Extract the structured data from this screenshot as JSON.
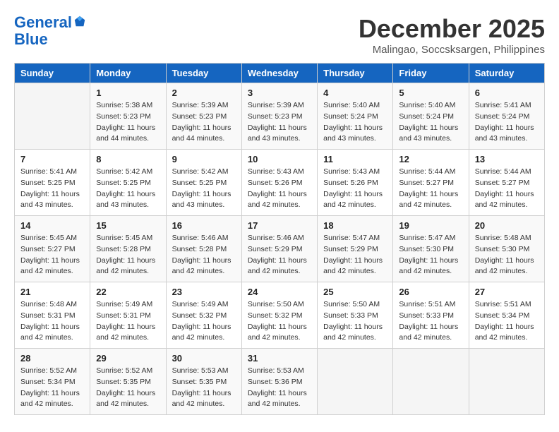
{
  "header": {
    "logo_line1": "General",
    "logo_line2": "Blue",
    "month": "December 2025",
    "location": "Malingao, Soccsksargen, Philippines"
  },
  "weekdays": [
    "Sunday",
    "Monday",
    "Tuesday",
    "Wednesday",
    "Thursday",
    "Friday",
    "Saturday"
  ],
  "weeks": [
    [
      {
        "day": "",
        "info": ""
      },
      {
        "day": "1",
        "info": "Sunrise: 5:38 AM\nSunset: 5:23 PM\nDaylight: 11 hours\nand 44 minutes."
      },
      {
        "day": "2",
        "info": "Sunrise: 5:39 AM\nSunset: 5:23 PM\nDaylight: 11 hours\nand 44 minutes."
      },
      {
        "day": "3",
        "info": "Sunrise: 5:39 AM\nSunset: 5:23 PM\nDaylight: 11 hours\nand 43 minutes."
      },
      {
        "day": "4",
        "info": "Sunrise: 5:40 AM\nSunset: 5:24 PM\nDaylight: 11 hours\nand 43 minutes."
      },
      {
        "day": "5",
        "info": "Sunrise: 5:40 AM\nSunset: 5:24 PM\nDaylight: 11 hours\nand 43 minutes."
      },
      {
        "day": "6",
        "info": "Sunrise: 5:41 AM\nSunset: 5:24 PM\nDaylight: 11 hours\nand 43 minutes."
      }
    ],
    [
      {
        "day": "7",
        "info": "Sunrise: 5:41 AM\nSunset: 5:25 PM\nDaylight: 11 hours\nand 43 minutes."
      },
      {
        "day": "8",
        "info": "Sunrise: 5:42 AM\nSunset: 5:25 PM\nDaylight: 11 hours\nand 43 minutes."
      },
      {
        "day": "9",
        "info": "Sunrise: 5:42 AM\nSunset: 5:25 PM\nDaylight: 11 hours\nand 43 minutes."
      },
      {
        "day": "10",
        "info": "Sunrise: 5:43 AM\nSunset: 5:26 PM\nDaylight: 11 hours\nand 42 minutes."
      },
      {
        "day": "11",
        "info": "Sunrise: 5:43 AM\nSunset: 5:26 PM\nDaylight: 11 hours\nand 42 minutes."
      },
      {
        "day": "12",
        "info": "Sunrise: 5:44 AM\nSunset: 5:27 PM\nDaylight: 11 hours\nand 42 minutes."
      },
      {
        "day": "13",
        "info": "Sunrise: 5:44 AM\nSunset: 5:27 PM\nDaylight: 11 hours\nand 42 minutes."
      }
    ],
    [
      {
        "day": "14",
        "info": "Sunrise: 5:45 AM\nSunset: 5:27 PM\nDaylight: 11 hours\nand 42 minutes."
      },
      {
        "day": "15",
        "info": "Sunrise: 5:45 AM\nSunset: 5:28 PM\nDaylight: 11 hours\nand 42 minutes."
      },
      {
        "day": "16",
        "info": "Sunrise: 5:46 AM\nSunset: 5:28 PM\nDaylight: 11 hours\nand 42 minutes."
      },
      {
        "day": "17",
        "info": "Sunrise: 5:46 AM\nSunset: 5:29 PM\nDaylight: 11 hours\nand 42 minutes."
      },
      {
        "day": "18",
        "info": "Sunrise: 5:47 AM\nSunset: 5:29 PM\nDaylight: 11 hours\nand 42 minutes."
      },
      {
        "day": "19",
        "info": "Sunrise: 5:47 AM\nSunset: 5:30 PM\nDaylight: 11 hours\nand 42 minutes."
      },
      {
        "day": "20",
        "info": "Sunrise: 5:48 AM\nSunset: 5:30 PM\nDaylight: 11 hours\nand 42 minutes."
      }
    ],
    [
      {
        "day": "21",
        "info": "Sunrise: 5:48 AM\nSunset: 5:31 PM\nDaylight: 11 hours\nand 42 minutes."
      },
      {
        "day": "22",
        "info": "Sunrise: 5:49 AM\nSunset: 5:31 PM\nDaylight: 11 hours\nand 42 minutes."
      },
      {
        "day": "23",
        "info": "Sunrise: 5:49 AM\nSunset: 5:32 PM\nDaylight: 11 hours\nand 42 minutes."
      },
      {
        "day": "24",
        "info": "Sunrise: 5:50 AM\nSunset: 5:32 PM\nDaylight: 11 hours\nand 42 minutes."
      },
      {
        "day": "25",
        "info": "Sunrise: 5:50 AM\nSunset: 5:33 PM\nDaylight: 11 hours\nand 42 minutes."
      },
      {
        "day": "26",
        "info": "Sunrise: 5:51 AM\nSunset: 5:33 PM\nDaylight: 11 hours\nand 42 minutes."
      },
      {
        "day": "27",
        "info": "Sunrise: 5:51 AM\nSunset: 5:34 PM\nDaylight: 11 hours\nand 42 minutes."
      }
    ],
    [
      {
        "day": "28",
        "info": "Sunrise: 5:52 AM\nSunset: 5:34 PM\nDaylight: 11 hours\nand 42 minutes."
      },
      {
        "day": "29",
        "info": "Sunrise: 5:52 AM\nSunset: 5:35 PM\nDaylight: 11 hours\nand 42 minutes."
      },
      {
        "day": "30",
        "info": "Sunrise: 5:53 AM\nSunset: 5:35 PM\nDaylight: 11 hours\nand 42 minutes."
      },
      {
        "day": "31",
        "info": "Sunrise: 5:53 AM\nSunset: 5:36 PM\nDaylight: 11 hours\nand 42 minutes."
      },
      {
        "day": "",
        "info": ""
      },
      {
        "day": "",
        "info": ""
      },
      {
        "day": "",
        "info": ""
      }
    ]
  ]
}
